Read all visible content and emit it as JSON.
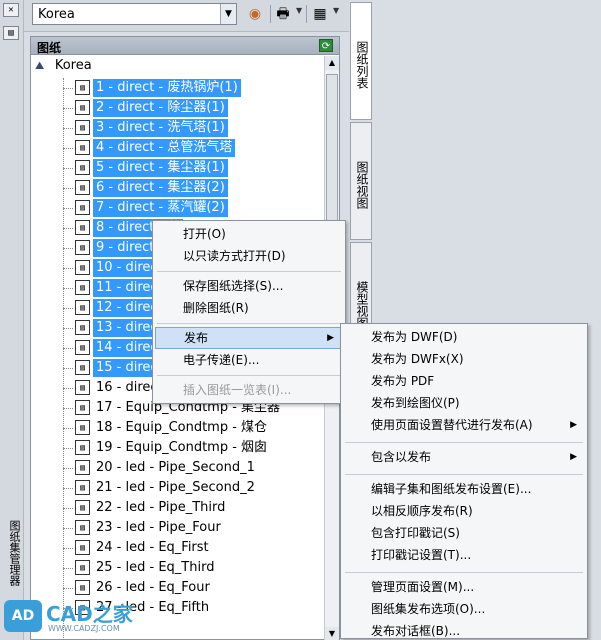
{
  "toolbar": {
    "combo_value": "Korea",
    "icons": [
      "sheet-set-icon",
      "publish-icon",
      "view-options-icon"
    ]
  },
  "left_strip": {
    "title": "图纸集管理器"
  },
  "panel": {
    "header": "图纸",
    "root_label": "Korea",
    "rows": [
      {
        "label": "1 - direct - 废热锅炉(1)",
        "selected": true
      },
      {
        "label": "2 - direct - 除尘器(1)",
        "selected": true
      },
      {
        "label": "3 - direct - 洗气塔(1)",
        "selected": true
      },
      {
        "label": "4 - direct - 总管洗气塔",
        "selected": true
      },
      {
        "label": "5 - direct - 集尘器(1)",
        "selected": true
      },
      {
        "label": "6 - direct - 集尘器(2)",
        "selected": true
      },
      {
        "label": "7 - direct - 蒸汽罐(2)",
        "selected": true
      },
      {
        "label": "8 - direct - 蒸",
        "selected": true
      },
      {
        "label": "9 - direct - 洗",
        "selected": true
      },
      {
        "label": "10 - direct - ",
        "selected": true
      },
      {
        "label": "11 - direct - ",
        "selected": true
      },
      {
        "label": "12 - direct - ",
        "selected": true
      },
      {
        "label": "13 - direct - ",
        "selected": true
      },
      {
        "label": "14 - direct - ",
        "selected": true
      },
      {
        "label": "15 - direct - ",
        "selected": true
      },
      {
        "label": "16 - direct - ",
        "selected": false
      },
      {
        "label": "17 - Equip_Condtmp - 集尘器",
        "selected": false
      },
      {
        "label": "18 - Equip_Condtmp - 煤仓",
        "selected": false
      },
      {
        "label": "19 - Equip_Condtmp - 烟囱",
        "selected": false
      },
      {
        "label": "20 - led - Pipe_Second_1",
        "selected": false
      },
      {
        "label": "21 - led - Pipe_Second_2",
        "selected": false
      },
      {
        "label": "22 - led - Pipe_Third",
        "selected": false
      },
      {
        "label": "23 - led - Pipe_Four",
        "selected": false
      },
      {
        "label": "24 - led - Eq_First",
        "selected": false
      },
      {
        "label": "25 - led - Eq_Third",
        "selected": false
      },
      {
        "label": "26 - led - Eq_Four",
        "selected": false
      },
      {
        "label": "27 - led - Eq_Fifth",
        "selected": false
      }
    ]
  },
  "side_tabs": [
    "图纸列表",
    "图纸视图",
    "模型视图"
  ],
  "context_menu": {
    "items": [
      {
        "label": "打开(O)",
        "state": "normal"
      },
      {
        "label": "以只读方式打开(D)",
        "state": "normal"
      },
      {
        "label": "保存图纸选择(S)...",
        "state": "normal"
      },
      {
        "label": "删除图纸(R)",
        "state": "normal"
      },
      {
        "label": "发布",
        "state": "highlighted",
        "submenu": true
      },
      {
        "label": "电子传递(E)...",
        "state": "normal"
      },
      {
        "label": "插入图纸一览表(I)...",
        "state": "disabled"
      }
    ]
  },
  "publish_submenu": {
    "items": [
      {
        "label": "发布为 DWF(D)"
      },
      {
        "label": "发布为 DWFx(X)"
      },
      {
        "label": "发布为 PDF"
      },
      {
        "label": "发布到绘图仪(P)"
      },
      {
        "label": "使用页面设置替代进行发布(A)",
        "submenu": true
      },
      {
        "label": "包含以发布",
        "submenu": true
      },
      {
        "label": "编辑子集和图纸发布设置(E)..."
      },
      {
        "label": "以相反顺序发布(R)"
      },
      {
        "label": "包含打印戳记(S)"
      },
      {
        "label": "打印戳记设置(T)..."
      },
      {
        "label": "管理页面设置(M)..."
      },
      {
        "label": "图纸集发布选项(O)..."
      },
      {
        "label": "发布对话框(B)..."
      }
    ]
  },
  "watermark": {
    "logo": "AD",
    "text": "CAD之家",
    "sub": "WWW.CADZJ.COM"
  }
}
